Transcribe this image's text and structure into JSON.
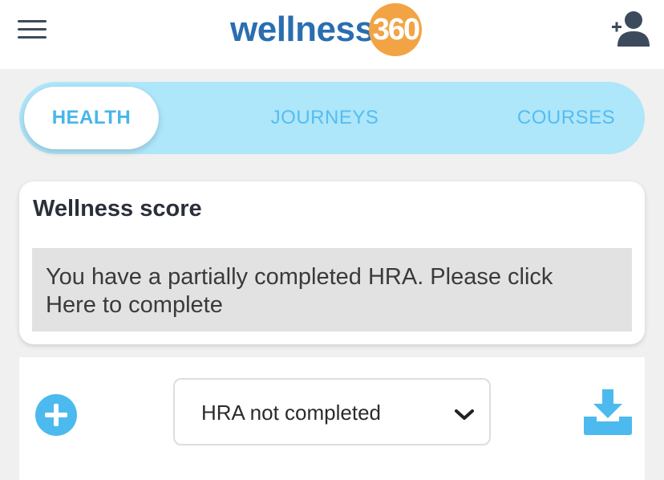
{
  "header": {
    "logo_word": "wellness",
    "logo_number": "360",
    "menu_icon": "hamburger-menu-icon",
    "add_user_icon": "add-user-icon"
  },
  "tabs": [
    {
      "label": "HEALTH",
      "active": true
    },
    {
      "label": "JOURNEYS",
      "active": false
    },
    {
      "label": "COURSES",
      "active": false
    }
  ],
  "wellness_score": {
    "title": "Wellness score",
    "message_line1": "You have a partially completed HRA. Please click",
    "message_line2": "Here to complete"
  },
  "actions": {
    "add_icon": "plus-circle-icon",
    "status_select_value": "HRA not completed",
    "chevron_icon": "chevron-down-icon",
    "download_icon": "download-icon"
  },
  "colors": {
    "brand_blue": "#2a6eb0",
    "brand_orange": "#f2a444",
    "accent_light_blue": "#55bdf0",
    "tab_bar_bg": "#aee6fa",
    "page_bg": "#f0f0f0"
  }
}
